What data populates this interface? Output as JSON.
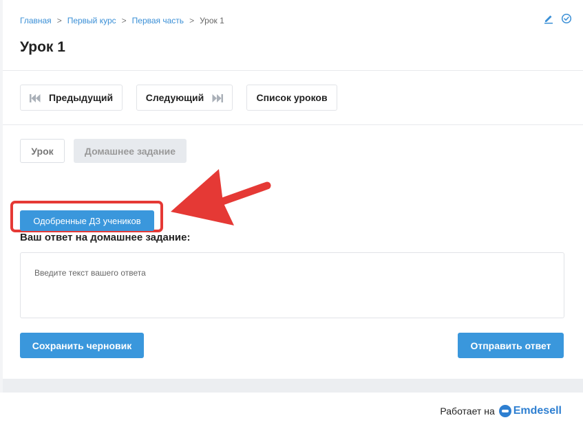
{
  "breadcrumb": {
    "home": "Главная",
    "course": "Первый курс",
    "part": "Первая часть",
    "current": "Урок 1",
    "separator": ">"
  },
  "page": {
    "title": "Урок 1"
  },
  "top_icons": [
    "pencil-icon",
    "check-circle-icon"
  ],
  "nav": {
    "prev_label": "Предыдущий",
    "next_label": "Следующий",
    "list_label": "Список уроков"
  },
  "tabs": {
    "lesson_label": "Урок",
    "homework_label": "Домашнее задание"
  },
  "homework": {
    "approved_button_label": "Одобренные ДЗ учеников",
    "answer_label": "Ваш ответ на домашнее задание:",
    "answer_placeholder": "Введите текст вашего ответа",
    "save_draft_label": "Сохранить черновик",
    "send_label": "Отправить ответ"
  },
  "footer": {
    "powered_by": "Работает на",
    "brand": "Emdesell"
  },
  "colors": {
    "accent": "#3a97dc",
    "link": "#3a8fd6",
    "highlight": "#e53935",
    "brand": "#2e7fd1"
  }
}
